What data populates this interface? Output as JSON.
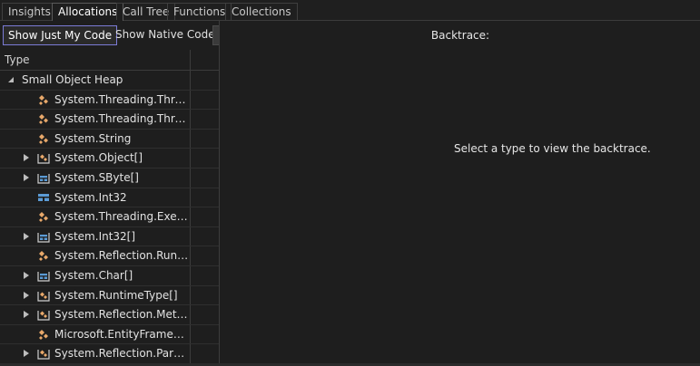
{
  "tabs": [
    {
      "label": "Insights",
      "active": false
    },
    {
      "label": "Allocations",
      "active": true
    },
    {
      "label": "Call Tree",
      "active": false
    },
    {
      "label": "Functions",
      "active": false
    },
    {
      "label": "Collections",
      "active": false
    }
  ],
  "toolbar": {
    "show_just_my_code": "Show Just My Code",
    "show_native_code": "Show Native Code"
  },
  "grid": {
    "column_type": "Type",
    "group_label": "Small Object Heap",
    "rows": [
      {
        "name": "System.Threading.Thread",
        "icon": "class-icon",
        "expandable": false
      },
      {
        "name": "System.Threading.Thread....",
        "icon": "class-icon",
        "expandable": false
      },
      {
        "name": "System.String",
        "icon": "class-icon",
        "expandable": false
      },
      {
        "name": "System.Object[]",
        "icon": "class-array-icon",
        "expandable": true
      },
      {
        "name": "System.SByte[]",
        "icon": "struct-array-icon",
        "expandable": true
      },
      {
        "name": "System.Int32",
        "icon": "struct-icon",
        "expandable": false
      },
      {
        "name": "System.Threading.Executi...",
        "icon": "class-icon",
        "expandable": false
      },
      {
        "name": "System.Int32[]",
        "icon": "struct-array-icon",
        "expandable": true
      },
      {
        "name": "System.Reflection.Runtim...",
        "icon": "class-icon",
        "expandable": false
      },
      {
        "name": "System.Char[]",
        "icon": "struct-array-icon",
        "expandable": true
      },
      {
        "name": "System.RuntimeType[]",
        "icon": "class-array-icon",
        "expandable": true
      },
      {
        "name": "System.Reflection.Metho...",
        "icon": "class-array-icon",
        "expandable": true
      },
      {
        "name": "Microsoft.EntityFramewor...",
        "icon": "class-icon",
        "expandable": false
      },
      {
        "name": "System.Reflection.Parame...",
        "icon": "class-array-icon",
        "expandable": true
      }
    ]
  },
  "backtrace": {
    "title": "Backtrace:",
    "message": "Select a type to view the backtrace."
  },
  "colors": {
    "class_icon": "#e8a86a",
    "struct_icon": "#5b9bd5",
    "button_outline": "#7b7bd6"
  }
}
